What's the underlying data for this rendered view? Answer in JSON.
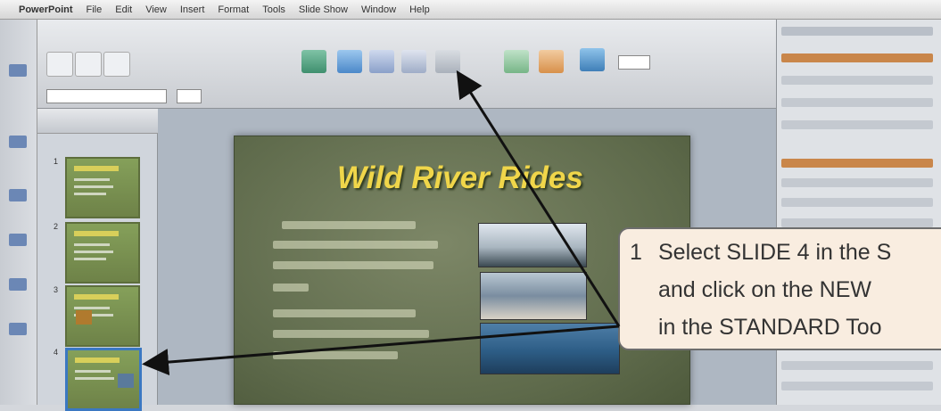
{
  "menubar": {
    "app_name": "PowerPoint",
    "items": [
      "File",
      "Edit",
      "View",
      "Insert",
      "Format",
      "Tools",
      "Slide Show",
      "Window",
      "Help"
    ]
  },
  "slide": {
    "title": "Wild River Rides"
  },
  "slides_panel": {
    "numbers": [
      "1",
      "2",
      "3",
      "4"
    ],
    "selected_number": "4"
  },
  "callout": {
    "number": "1",
    "lines": [
      "Select SLIDE 4 in the S",
      "and click on the NEW",
      "in the STANDARD Too"
    ]
  },
  "colors": {
    "title_yellow": "#f0d64a",
    "callout_bg": "#f9ede0",
    "selection_blue": "#3b78c2",
    "arrow": "#111111"
  }
}
